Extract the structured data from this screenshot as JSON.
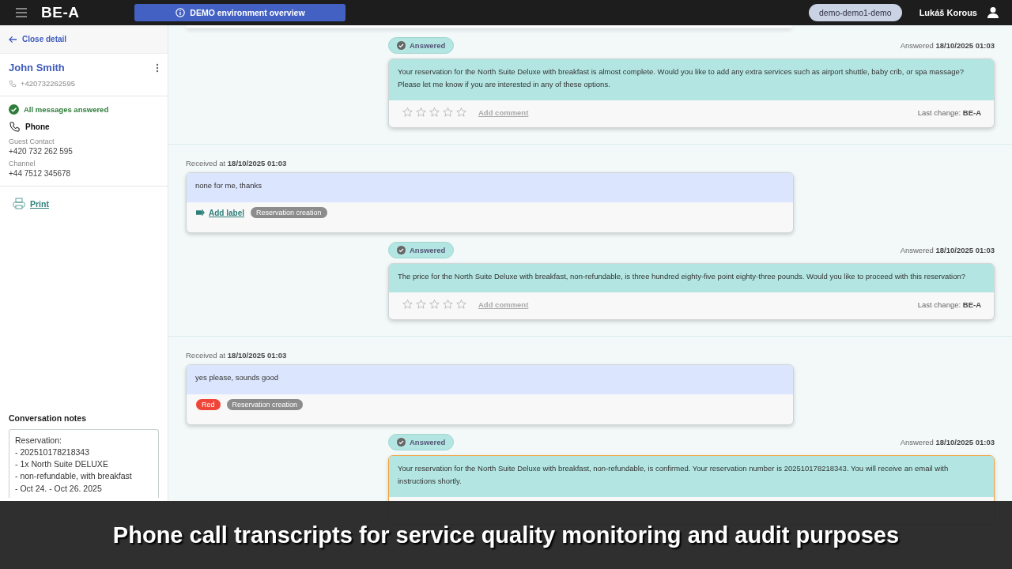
{
  "header": {
    "logo": "BE-A",
    "banner": "DEMO environment overview",
    "environment": "demo-demo1-demo",
    "user": "Lukáš Korous"
  },
  "sidebar": {
    "close": "Close detail",
    "contact": {
      "name": "John Smith",
      "phone": "+420732262595"
    },
    "status": "All messages answered",
    "channel_type": "Phone",
    "fields": [
      {
        "label": "Guest Contact",
        "value": "+420 732 262 595"
      },
      {
        "label": "Channel",
        "value": "+44 7512 345678"
      }
    ],
    "print": "Print",
    "notes": {
      "title": "Conversation notes",
      "value": "Reservation:\n- 202510178218343\n- 1x North Suite DELUXE\n- non-refundable, with breakfast\n- Oct 24. - Oct 26. 2025"
    }
  },
  "exchanges": [
    {
      "answer": {
        "status": "Answered",
        "label": "Answered",
        "time": "18/10/2025 01:03",
        "text": "Your reservation for the North Suite Deluxe with breakfast is almost complete. Would you like to add any extra services such as airport shuttle, baby crib, or spa massage? Please let me know if you are interested in any of these options.",
        "stars": 0,
        "comment": "Add comment",
        "change_label": "Last change:",
        "change_by": "BE-A",
        "highlighted": false
      }
    },
    {
      "received": {
        "label": "Received at",
        "time": "18/10/2025 01:03",
        "text": "none for me, thanks",
        "add_label": "Add label",
        "tags": [
          {
            "text": "Reservation creation",
            "color": "#8c8c8c"
          }
        ]
      },
      "answer": {
        "status": "Answered",
        "label": "Answered",
        "time": "18/10/2025 01:03",
        "text": "The price for the North Suite Deluxe with breakfast, non-refundable, is three hundred eighty-five point eighty-three pounds. Would you like to proceed with this reservation?",
        "stars": 0,
        "comment": "Add comment",
        "change_label": "Last change:",
        "change_by": "BE-A",
        "highlighted": false
      }
    },
    {
      "received": {
        "label": "Received at",
        "time": "18/10/2025 01:03",
        "text": "yes please, sounds good",
        "tags": [
          {
            "text": "Red",
            "color": "#f04438"
          },
          {
            "text": "Reservation creation",
            "color": "#8c8c8c"
          }
        ]
      },
      "answer": {
        "status": "Answered",
        "label": "Answered",
        "time": "18/10/2025 01:03",
        "text": "Your reservation for the North Suite Deluxe with breakfast, non-refundable, is confirmed. Your reservation number is 202510178218343. You will receive an email with instructions shortly.",
        "highlighted": true
      }
    }
  ],
  "caption": "Phone call transcripts for service quality monitoring and audit purposes"
}
